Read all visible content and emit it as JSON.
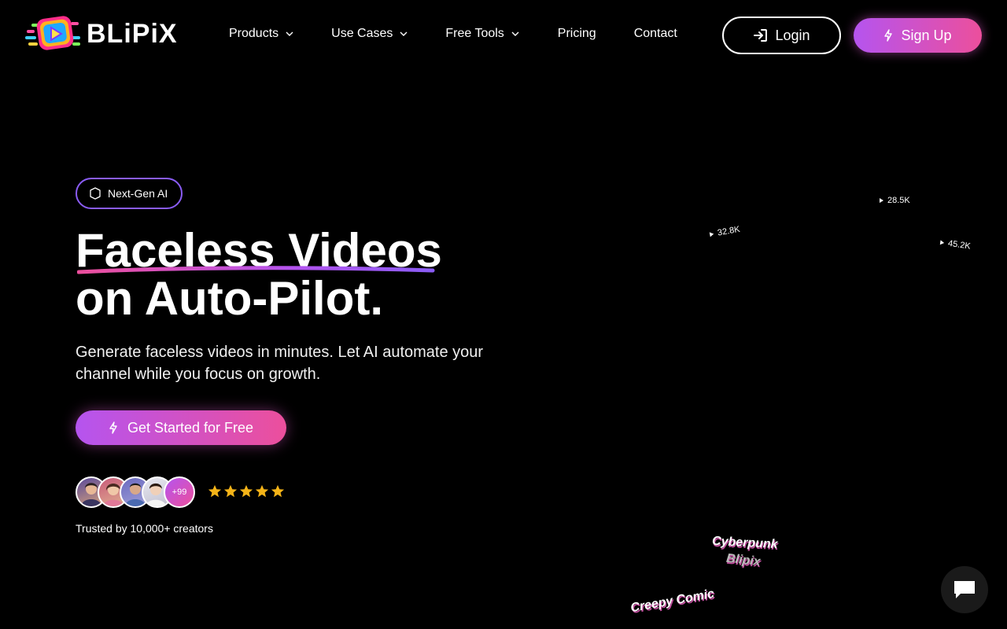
{
  "brand": {
    "name": "BLiPiX"
  },
  "nav": {
    "items": [
      {
        "label": "Products",
        "has_dropdown": true
      },
      {
        "label": "Use Cases",
        "has_dropdown": true
      },
      {
        "label": "Free Tools",
        "has_dropdown": true
      },
      {
        "label": "Pricing",
        "has_dropdown": false
      },
      {
        "label": "Contact",
        "has_dropdown": false
      }
    ],
    "login_label": "Login",
    "signup_label": "Sign Up"
  },
  "hero": {
    "badge": "Next-Gen AI",
    "headline_line1": "Faceless Videos",
    "headline_line2": "on Auto-Pilot.",
    "subtext": "Generate faceless videos in minutes. Let AI automate your channel while you focus on growth.",
    "cta_label": "Get Started for Free",
    "avatar_more": "+99",
    "rating_stars": 5,
    "trusted": "Trusted by 10,000+ creators"
  },
  "showcase": {
    "stats": [
      "28.5K",
      "32.8K",
      "45.2K"
    ],
    "styles": [
      "Cyberpunk",
      "Blipix",
      "Creepy Comic"
    ]
  },
  "colors": {
    "accent_start": "#b554ef",
    "accent_end": "#ec4f9c",
    "badge_border": "#8a5cf5",
    "star": "#f5b418"
  },
  "icons": [
    "login-icon",
    "bolt-icon",
    "chevron-down-icon",
    "cube-icon",
    "star-icon",
    "chat-icon"
  ]
}
